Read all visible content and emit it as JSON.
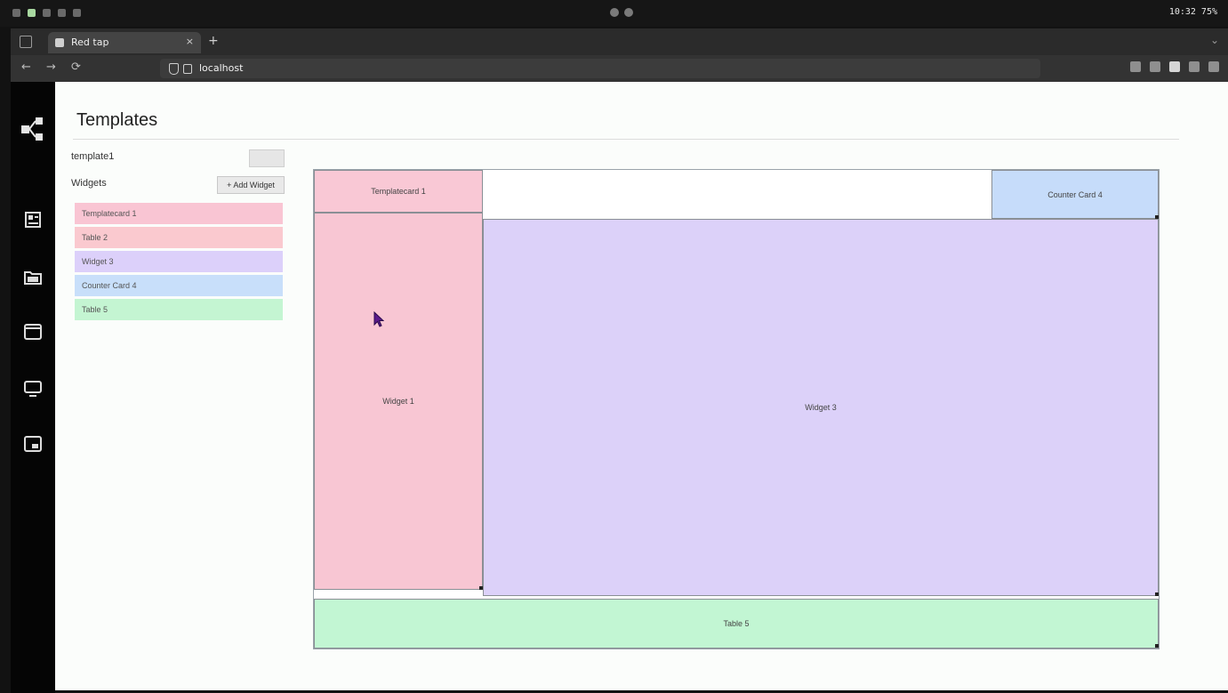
{
  "os": {
    "clock": "10:32 75%"
  },
  "browser": {
    "tab_title": "Red tap",
    "tab_close": "×",
    "new_tab": "+",
    "url_host": "localhost",
    "url_rest": "",
    "nav": {
      "back": "←",
      "forward": "→",
      "reload": "⟳"
    }
  },
  "app": {
    "title": "Templates",
    "name_label": "template1",
    "save_label": "",
    "widgets_label": "Widgets",
    "add_widget_label": "+ Add Widget",
    "widgets": [
      {
        "label": "Templatecard 1",
        "color": "#f9c5d3"
      },
      {
        "label": "Table 2",
        "color": "#fac9cf"
      },
      {
        "label": "Widget 3",
        "color": "#dcd0fa"
      },
      {
        "label": "Counter Card 4",
        "color": "#c8dffa"
      },
      {
        "label": "Table 5",
        "color": "#c4f5d2"
      }
    ]
  },
  "canvas": {
    "regions": {
      "template": {
        "label": "Templatecard 1",
        "color": "#f9c8d5"
      },
      "counter": {
        "label": "Counter Card 4",
        "color": "#c6dcfa"
      },
      "left": {
        "label": "Widget 1",
        "color": "#f8c6d3"
      },
      "main": {
        "label": "Widget 3",
        "color": "#dcd1f9"
      },
      "bottom": {
        "label": "Table 5",
        "color": "#c2f6d3"
      }
    }
  },
  "colors": {
    "rail": "#050505",
    "accent": "#5a1a8a"
  }
}
